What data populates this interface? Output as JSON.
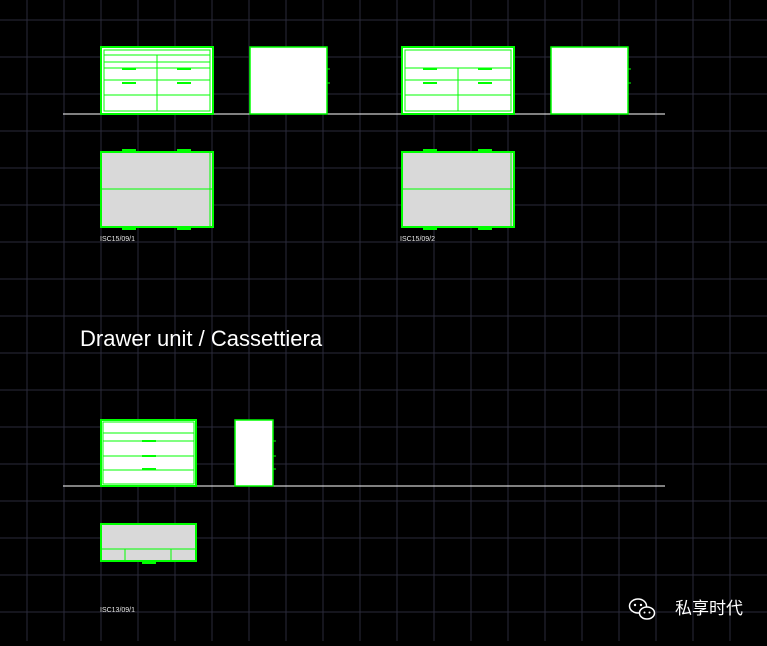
{
  "title": "Drawer unit / Cassettiera",
  "labels": {
    "code_a": "ISC15/09/1",
    "code_b": "ISC15/09/2",
    "code_c": "ISC13/09/1"
  },
  "watermark": {
    "icon": "wechat-icon",
    "text": "私享时代"
  },
  "colors": {
    "background": "#000000",
    "grid": "#2a2a3a",
    "outline": "#00ff00",
    "fill_plan": "#d9d9d9",
    "fill_elevation": "#ffffff",
    "baseline": "#ffffff"
  }
}
